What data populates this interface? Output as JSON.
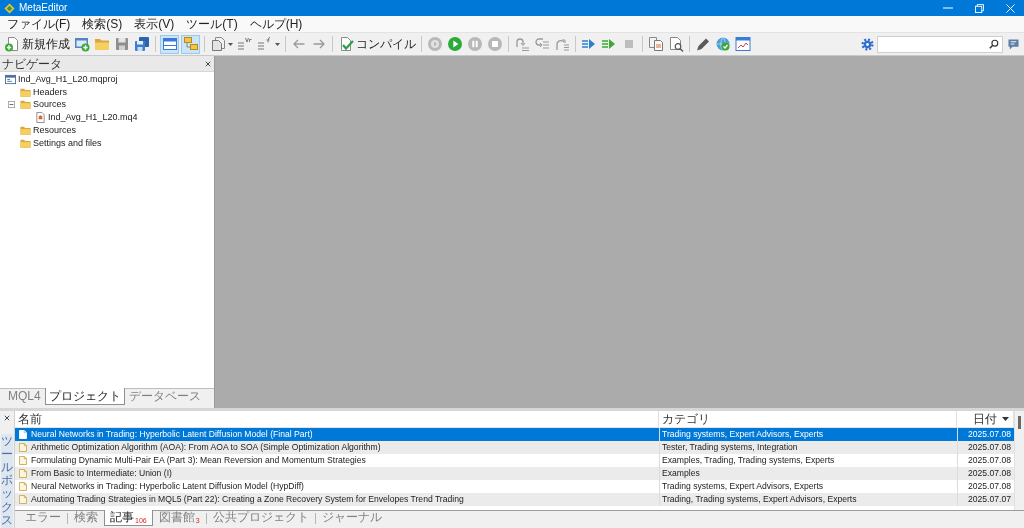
{
  "window": {
    "title": "MetaEditor"
  },
  "menu": [
    "ファイル(F)",
    "検索(S)",
    "表示(V)",
    "ツール(T)",
    "ヘルプ(H)"
  ],
  "toolbar": {
    "new_button": "新規作成",
    "view_toggles": [
      {
        "on": true
      },
      {
        "on": true
      }
    ],
    "compile_button": "コンパイル"
  },
  "navigator": {
    "title": "ナビゲータ",
    "tree": [
      {
        "label": "Ind_Avg_H1_L20.mqproj",
        "kind": "project",
        "children": [
          {
            "label": "Headers",
            "kind": "folder"
          },
          {
            "label": "Sources",
            "kind": "folder",
            "expanded": true,
            "children": [
              {
                "label": "Ind_Avg_H1_L20.mq4",
                "kind": "file"
              }
            ]
          },
          {
            "label": "Resources",
            "kind": "folder"
          },
          {
            "label": "Settings and files",
            "kind": "folder"
          }
        ]
      }
    ],
    "tabs": [
      {
        "label": "MQL4",
        "selected": false
      },
      {
        "label": "プロジェクト",
        "selected": true
      },
      {
        "label": "データベース",
        "selected": false
      }
    ]
  },
  "toolbox": {
    "title": "ツールボックス",
    "columns": [
      {
        "label": "名前"
      },
      {
        "label": "カテゴリ"
      },
      {
        "label": "日付",
        "sorted": true
      }
    ],
    "rows": [
      {
        "name": "Neural Networks in Trading: Hyperbolic Latent Diffusion Model (Final Part)",
        "category": "Trading systems, Expert Advisors, Experts",
        "date": "2025.07.08",
        "selected": true
      },
      {
        "name": "Arithmetic Optimization Algorithm (AOA): From AOA to SOA (Simple Optimization Algorithm)",
        "category": "Tester, Trading systems, Integration",
        "date": "2025.07.08",
        "selected": false
      },
      {
        "name": "Formulating Dynamic Multi-Pair EA (Part 3): Mean Reversion and Momentum Strategies",
        "category": "Examples, Trading, Trading systems, Experts",
        "date": "2025.07.08",
        "selected": false
      },
      {
        "name": "From Basic to Intermediate: Union (I)",
        "category": "Examples",
        "date": "2025.07.08",
        "selected": false
      },
      {
        "name": "Neural Networks in Trading: Hyperbolic Latent Diffusion Model (HypDiff)",
        "category": "Trading systems, Expert Advisors, Experts",
        "date": "2025.07.08",
        "selected": false
      },
      {
        "name": "Automating Trading Strategies in MQL5 (Part 22): Creating a Zone Recovery System for Envelopes Trend Trading",
        "category": "Trading, Trading systems, Expert Advisors, Experts",
        "date": "2025.07.07",
        "selected": false
      }
    ],
    "tabs": [
      {
        "label": "エラー",
        "selected": false
      },
      {
        "label": "検索",
        "selected": false
      },
      {
        "label": "記事",
        "count": "106",
        "selected": true
      },
      {
        "label": "図書館",
        "count": "3",
        "selected": false
      },
      {
        "label": "公共プロジェクト",
        "selected": false
      },
      {
        "label": "ジャーナル",
        "selected": false
      }
    ]
  }
}
